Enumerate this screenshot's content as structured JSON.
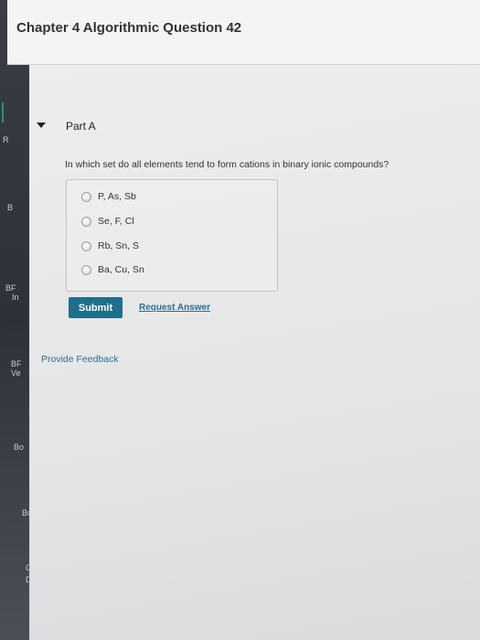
{
  "header": {
    "title": "Chapter 4 Algorithmic Question 42"
  },
  "sidebar": {
    "fragments": [
      "R",
      "B",
      "BF",
      "In",
      "BF",
      "Ve",
      "Bo",
      "Bo",
      "G",
      "D"
    ]
  },
  "part": {
    "title": "Part A",
    "question": "In which set do all elements tend to form cations in binary ionic compounds?",
    "options": [
      {
        "label": "P, As, Sb"
      },
      {
        "label": "Se, F, Cl"
      },
      {
        "label": "Rb, Sn, S"
      },
      {
        "label": "Ba, Cu, Sn"
      }
    ]
  },
  "actions": {
    "submit_label": "Submit",
    "request_answer_label": "Request Answer"
  },
  "footer": {
    "feedback_label": "Provide Feedback"
  },
  "colors": {
    "submit_bg": "#1f6f8b",
    "link": "#2c6e94"
  }
}
